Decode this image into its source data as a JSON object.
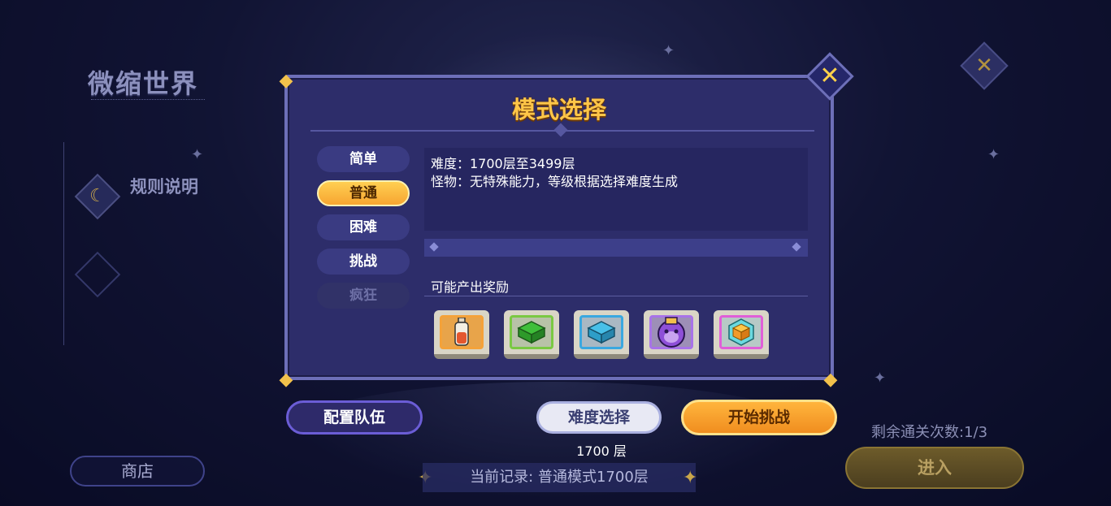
{
  "world": {
    "title": "微缩世界"
  },
  "side": {
    "rules_label": "规则说明",
    "shop_label": "商店"
  },
  "right": {
    "remaining": "剩余通关次数:1/3",
    "enter_label": "进入"
  },
  "bottom": {
    "team_label": "配置队伍",
    "difficulty_label": "难度选择",
    "layer": "1700 层",
    "start_label": "开始挑战",
    "record": "当前记录: 普通模式1700层"
  },
  "modal": {
    "title": "模式选择",
    "tabs": [
      {
        "label": "简单",
        "state": "normal"
      },
      {
        "label": "普通",
        "state": "active"
      },
      {
        "label": "困难",
        "state": "normal"
      },
      {
        "label": "挑战",
        "state": "normal"
      },
      {
        "label": "疯狂",
        "state": "disabled"
      }
    ],
    "description": {
      "difficulty": "难度：1700层至3499层",
      "monster": "怪物：无特殊能力，等级根据选择难度生成"
    },
    "rewards_title": "可能产出奖励",
    "rewards": [
      {
        "icon": "potion-bottle-icon",
        "frame_color": "#f4a23a"
      },
      {
        "icon": "green-rune-cube-icon",
        "frame_color": "#7ac943"
      },
      {
        "icon": "blue-rune-cube-icon",
        "frame_color": "#3aa8e0"
      },
      {
        "icon": "purple-monkey-mask-icon",
        "frame_color": "#a873e8"
      },
      {
        "icon": "orange-cube-icon",
        "frame_color": "#e05fd8"
      }
    ]
  },
  "colors": {
    "accent": "#ffc648",
    "panel": "#2d2d6a",
    "active_tab": "#f7a531"
  }
}
